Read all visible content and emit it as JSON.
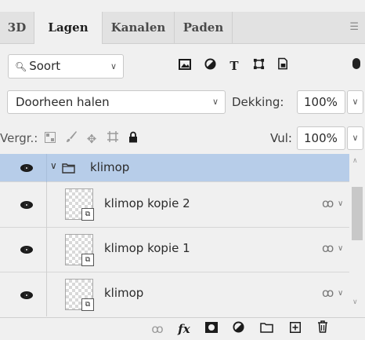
{
  "tabs": [
    "3D",
    "Lagen",
    "Kanalen",
    "Paden"
  ],
  "filter": {
    "kind_label": "Soort",
    "icons": [
      "image-filter-icon",
      "adjustment-filter-icon",
      "type-filter-icon",
      "shape-filter-icon",
      "smart-object-filter-icon"
    ],
    "type_glyph": "T"
  },
  "blend": {
    "mode": "Doorheen halen",
    "opacity_label": "Dekking:",
    "opacity_value": "100%"
  },
  "lock": {
    "label": "Vergr.:",
    "fill_label": "Vul:",
    "fill_value": "100%"
  },
  "layers": [
    {
      "name": "klimop",
      "type": "group",
      "selected": true,
      "expanded": true
    },
    {
      "name": "klimop kopie 2",
      "type": "smart-object"
    },
    {
      "name": "klimop kopie 1",
      "type": "smart-object"
    },
    {
      "name": "klimop",
      "type": "smart-object"
    }
  ],
  "bottom_bar": {
    "fx_label": "fx",
    "icons": [
      "link-icon",
      "fx-icon",
      "mask-icon",
      "adjustment-icon",
      "folder-icon",
      "new-layer-icon",
      "trash-icon"
    ]
  },
  "colors": {
    "selected_row": "#b7cde9",
    "panel_bg": "#f0f0f0",
    "tab_bar": "#e2e2e2"
  }
}
